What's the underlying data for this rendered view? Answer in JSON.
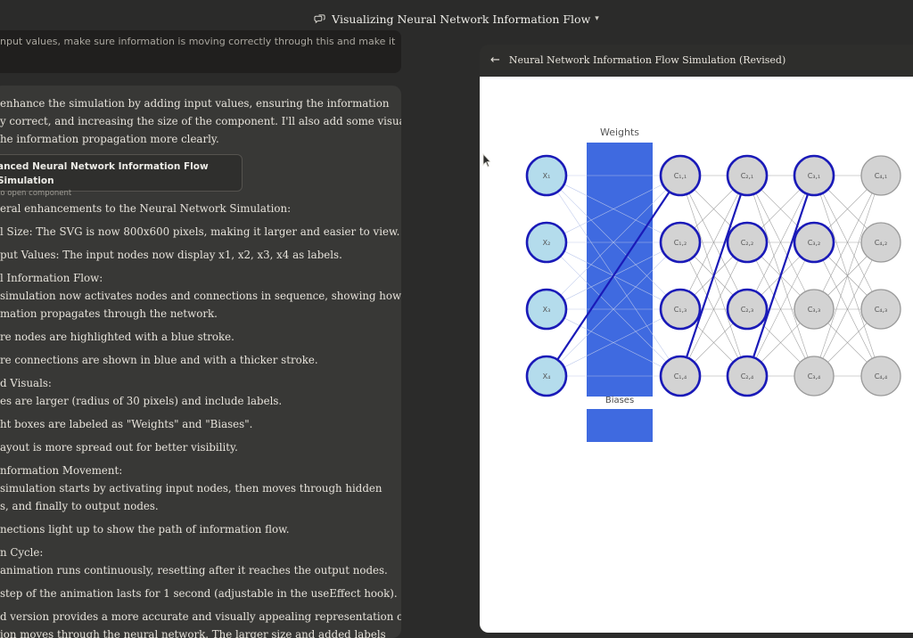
{
  "topbar": {
    "title": "Visualizing Neural Network Information Flow",
    "icon": "chat-bubbles-icon"
  },
  "user_message": {
    "text": "nput values, make sure information is moving correctly through this and make it"
  },
  "assistant_message": {
    "intro": [
      "enhance the simulation by adding input values, ensuring the information",
      "y correct, and increasing the size of the component. I'll also add some visual",
      "he information propagation more clearly."
    ],
    "artifact": {
      "title": "anced Neural Network Information Flow Simulation",
      "subtitle": " to open component"
    },
    "lines": [
      "eral enhancements to the Neural Network Simulation:",
      "l Size: The SVG is now 800x600 pixels, making it larger and easier to view.",
      "put Values: The input nodes now display x1, x2, x3, x4 as labels.",
      "l Information Flow:",
      "simulation now activates nodes and connections in sequence, showing how",
      "mation propagates through the network.",
      "re nodes are highlighted with a blue stroke.",
      "re connections are shown in blue and with a thicker stroke.",
      "d Visuals:",
      "es are larger (radius of 30 pixels) and include labels.",
      "ht boxes are labeled as \"Weights\" and \"Biases\".",
      "ayout is more spread out for better visibility.",
      "nformation Movement:",
      "simulation starts by activating input nodes, then moves through hidden",
      "s, and finally to output nodes.",
      "nections light up to show the path of information flow.",
      "n Cycle:",
      "animation runs continuously, resetting after it reaches the output nodes.",
      " step of the animation lasts for 1 second (adjustable in the useEffect hook).",
      "d version provides a more accurate and visually appealing representation of",
      "ion moves through the neural network. The larger size and added labels"
    ]
  },
  "artifact_panel": {
    "title": "Neural Network Information Flow Simulation (Revised)",
    "back_icon": "arrow-left-icon"
  },
  "network": {
    "weights_label": "Weights",
    "biases_label": "Biases",
    "colors": {
      "input_fill": "#b4dcec",
      "active_stroke": "#1a1ab8",
      "inactive_fill": "#d3d3d3",
      "inactive_stroke": "#9a9a9a",
      "box": "#3f6ae0",
      "edge": "#9a9a9a",
      "active_edge": "#1a1ab8"
    },
    "layers": [
      {
        "name": "input",
        "labels": [
          "X₁",
          "X₂",
          "X₃",
          "X₄"
        ],
        "active": [
          true,
          true,
          true,
          true
        ]
      },
      {
        "name": "hidden-1",
        "labels": [
          "C₁,₁",
          "C₁,₂",
          "C₁,₃",
          "C₁,₄"
        ],
        "active": [
          true,
          true,
          true,
          true
        ]
      },
      {
        "name": "hidden-2",
        "labels": [
          "C₂,₁",
          "C₂,₂",
          "C₂,₃",
          "C₂,₄"
        ],
        "active": [
          true,
          true,
          true,
          true
        ]
      },
      {
        "name": "hidden-3",
        "labels": [
          "C₃,₁",
          "C₃,₂",
          "C₃,₃",
          "C₃,₄"
        ],
        "active": [
          true,
          true,
          false,
          false
        ]
      },
      {
        "name": "hidden-4",
        "labels": [
          "C₄,₁",
          "C₄,₂",
          "C₄,₃",
          "C₄,₄"
        ],
        "active": [
          false,
          false,
          false,
          false
        ]
      }
    ],
    "active_connections": [
      {
        "from": [
          0,
          3
        ],
        "to": [
          1,
          0
        ]
      },
      {
        "from": [
          1,
          3
        ],
        "to": [
          2,
          0
        ]
      },
      {
        "from": [
          2,
          3
        ],
        "to": [
          3,
          0
        ]
      }
    ]
  }
}
